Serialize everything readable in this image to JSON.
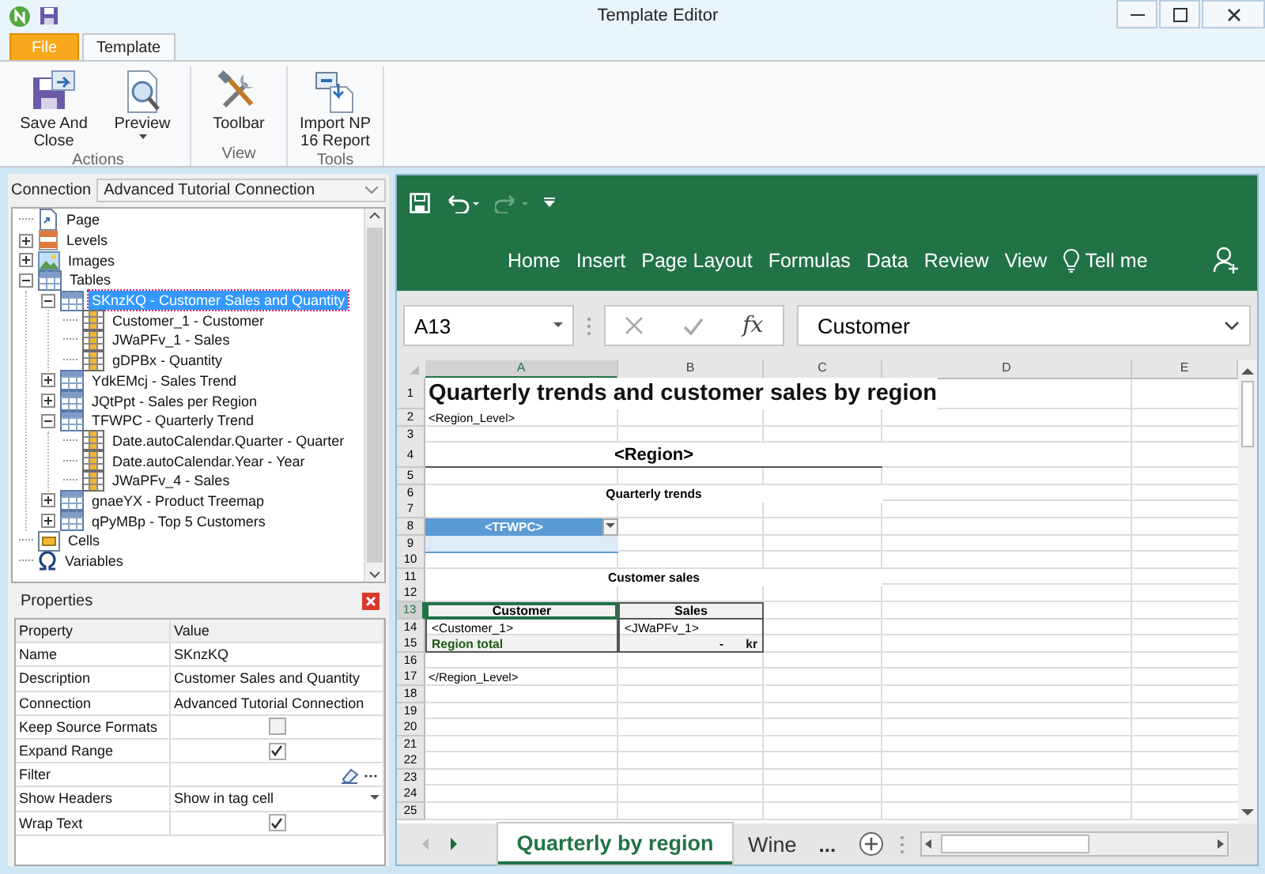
{
  "window": {
    "title": "Template Editor"
  },
  "ribbon": {
    "tabs": [
      {
        "label": "File",
        "kind": "file",
        "selected": false
      },
      {
        "label": "Template",
        "kind": "tab",
        "selected": true
      }
    ],
    "groups": [
      {
        "label": "Actions",
        "buttons": [
          {
            "label": "Save And Close",
            "kind": "save",
            "dropdown": false
          },
          {
            "label": "Preview",
            "kind": "preview",
            "dropdown": true
          }
        ]
      },
      {
        "label": "View",
        "buttons": [
          {
            "label": "Toolbar",
            "kind": "tools",
            "dropdown": false
          }
        ]
      },
      {
        "label": "Tools",
        "buttons": [
          {
            "label": "Import NP 16 Report",
            "kind": "import",
            "dropdown": false
          }
        ]
      }
    ]
  },
  "connection": {
    "label": "Connection",
    "value": "Advanced Tutorial Connection"
  },
  "tree": {
    "items": [
      {
        "label": "Page",
        "kind": "page",
        "selected": false
      },
      {
        "label": "Levels",
        "kind": "levels",
        "selected": false,
        "expanded": false
      },
      {
        "label": "Images",
        "kind": "images",
        "selected": false,
        "expanded": false
      },
      {
        "label": "Tables",
        "kind": "tables",
        "selected": false,
        "expanded": true,
        "children": [
          {
            "label": "SKnzKQ - Customer Sales and Quantity",
            "kind": "table",
            "selected": true,
            "expanded": true,
            "children": [
              {
                "label": "Customer_1 - Customer",
                "kind": "field",
                "selected": false
              },
              {
                "label": "JWaPFv_1 - Sales",
                "kind": "field",
                "selected": false
              },
              {
                "label": "gDPBx - Quantity",
                "kind": "field",
                "selected": false
              }
            ]
          },
          {
            "label": "YdkEMcj - Sales Trend",
            "kind": "table",
            "selected": false,
            "expanded": false
          },
          {
            "label": "JQtPpt - Sales per Region",
            "kind": "table",
            "selected": false,
            "expanded": false
          },
          {
            "label": "TFWPC - Quarterly Trend",
            "kind": "table",
            "selected": false,
            "expanded": true,
            "children": [
              {
                "label": "Date.autoCalendar.Quarter - Quarter",
                "kind": "field",
                "selected": false
              },
              {
                "label": "Date.autoCalendar.Year - Year",
                "kind": "field",
                "selected": false
              },
              {
                "label": "JWaPFv_4 - Sales",
                "kind": "field",
                "selected": false
              }
            ]
          },
          {
            "label": "gnaeYX - Product Treemap",
            "kind": "table",
            "selected": false,
            "expanded": false
          },
          {
            "label": "qPyMBp - Top 5 Customers",
            "kind": "table",
            "selected": false,
            "expanded": false
          }
        ]
      },
      {
        "label": "Cells",
        "kind": "cells",
        "selected": false
      },
      {
        "label": "Variables",
        "kind": "variables",
        "selected": false
      }
    ]
  },
  "properties": {
    "title": "Properties",
    "columns": [
      "Property",
      "Value"
    ],
    "rows": [
      {
        "name": "Name",
        "kind": "text",
        "value": "SKnzKQ"
      },
      {
        "name": "Description",
        "kind": "text",
        "value": "Customer Sales and Quantity"
      },
      {
        "name": "Connection",
        "kind": "text",
        "value": "Advanced Tutorial Connection"
      },
      {
        "name": "Keep Source Formats",
        "kind": "checkbox",
        "checked": false
      },
      {
        "name": "Expand Range",
        "kind": "checkbox",
        "checked": true
      },
      {
        "name": "Filter",
        "kind": "filter"
      },
      {
        "name": "Show Headers",
        "kind": "dropdown",
        "value": "Show in tag cell"
      },
      {
        "name": "Wrap Text",
        "kind": "checkbox",
        "checked": true
      }
    ]
  },
  "excel": {
    "tabs": [
      "Home",
      "Insert",
      "Page Layout",
      "Formulas",
      "Data",
      "Review",
      "View"
    ],
    "tell_me": "Tell me",
    "name_box": "A13",
    "formula": "Customer",
    "fx": "fx",
    "columns": [
      {
        "label": "A",
        "selected": true
      },
      {
        "label": "B",
        "selected": false
      },
      {
        "label": "C",
        "selected": false
      },
      {
        "label": "D",
        "selected": false
      },
      {
        "label": "E",
        "selected": false
      }
    ],
    "rows": [
      {
        "number": "1",
        "kind": "title",
        "selected": false,
        "cells": [
          {
            "text": "Quarterly trends and customer sales by region"
          }
        ]
      },
      {
        "number": "2",
        "kind": "tag",
        "selected": false,
        "cells": [
          {
            "text": "<Region_Level>"
          }
        ]
      },
      {
        "number": "3",
        "kind": "blank",
        "selected": false
      },
      {
        "number": "4",
        "kind": "banner",
        "selected": false,
        "cells": [
          {
            "text": "<Region>"
          }
        ]
      },
      {
        "number": "5",
        "kind": "blank",
        "selected": false
      },
      {
        "number": "6",
        "kind": "section",
        "selected": false,
        "cells": [
          {
            "text": "Quarterly trends"
          }
        ]
      },
      {
        "number": "7",
        "kind": "blank",
        "selected": false
      },
      {
        "number": "8",
        "kind": "range_tag",
        "selected": false,
        "cells": [
          {
            "text": "<TFWPC>"
          }
        ]
      },
      {
        "number": "9",
        "kind": "range_body",
        "selected": false
      },
      {
        "number": "10",
        "kind": "blank",
        "selected": false
      },
      {
        "number": "11",
        "kind": "section",
        "selected": false,
        "cells": [
          {
            "text": "Customer sales"
          }
        ]
      },
      {
        "number": "12",
        "kind": "blank",
        "selected": false
      },
      {
        "number": "13",
        "kind": "header",
        "selected": true,
        "cells": [
          {
            "text": "Customer",
            "selected": true
          },
          {
            "text": "Sales",
            "selected": false
          }
        ]
      },
      {
        "number": "14",
        "kind": "data",
        "selected": false,
        "cells": [
          {
            "text": "<Customer_1>",
            "selected": false
          },
          {
            "text": "<JWaPFv_1>",
            "selected": false
          }
        ]
      },
      {
        "number": "15",
        "kind": "total",
        "selected": false,
        "cells": [
          {
            "text": "Region total",
            "selected": false
          },
          {
            "text": "-",
            "suffix": "kr",
            "selected": false
          }
        ]
      },
      {
        "number": "16",
        "kind": "blank",
        "selected": false
      },
      {
        "number": "17",
        "kind": "tag",
        "selected": false,
        "cells": [
          {
            "text": "</Region_Level>"
          }
        ]
      },
      {
        "number": "18",
        "kind": "blank",
        "selected": false
      },
      {
        "number": "19",
        "kind": "blank",
        "selected": false
      },
      {
        "number": "20",
        "kind": "blank",
        "selected": false
      },
      {
        "number": "21",
        "kind": "blank",
        "selected": false
      },
      {
        "number": "22",
        "kind": "blank",
        "selected": false
      },
      {
        "number": "23",
        "kind": "blank",
        "selected": false
      },
      {
        "number": "24",
        "kind": "blank",
        "selected": false
      },
      {
        "number": "25",
        "kind": "blank",
        "selected": false
      }
    ],
    "sheet_tabs": [
      {
        "label": "Quarterly by region",
        "selected": true
      },
      {
        "label": "Wine",
        "selected": false
      }
    ],
    "more_tabs": "..."
  }
}
